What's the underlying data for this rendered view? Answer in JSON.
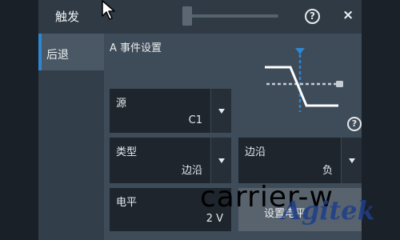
{
  "window": {
    "title": "触发",
    "help_icon": "question-circle-icon",
    "help_label": "?",
    "close_icon": "close-icon",
    "close_label": "×"
  },
  "nav": {
    "items": [
      {
        "label": "后退",
        "selected": true
      }
    ]
  },
  "event": {
    "section_label": "A 事件设置",
    "diagram_icon": "falling-edge-trigger-diagram",
    "help_label": "?"
  },
  "fields": {
    "source": {
      "label": "源",
      "value": "C1"
    },
    "type": {
      "label": "类型",
      "value": "边沿"
    },
    "slope": {
      "label": "边沿",
      "value": "负"
    },
    "level": {
      "label": "电平",
      "value": "2 V"
    }
  },
  "bottom_button": {
    "label": "设置电平"
  },
  "watermark": {
    "text_1": "carrier-w",
    "text_2": "Agitek"
  },
  "colors": {
    "accent": "#2f86d1",
    "panel": "#3e4b58",
    "field_bg": "#1e252d",
    "watermark_brand": "#1e3f8a"
  }
}
